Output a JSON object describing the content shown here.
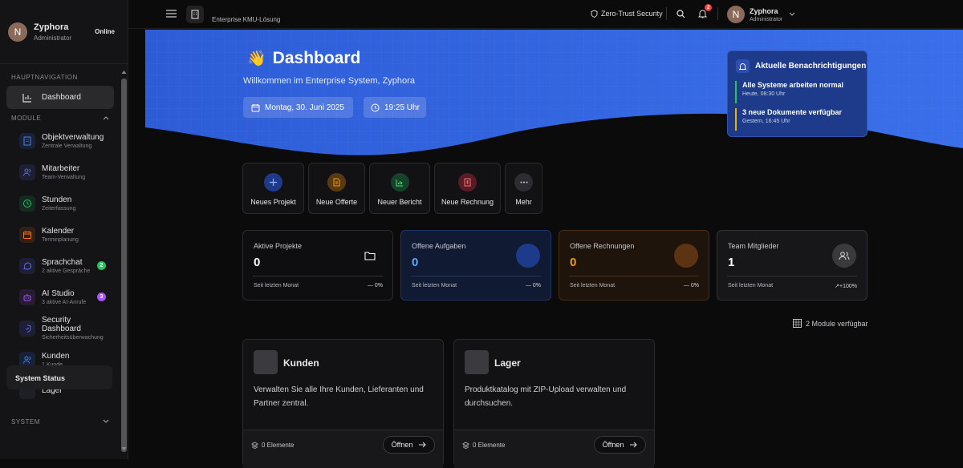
{
  "sidebar": {
    "user": {
      "initial": "N",
      "name": "Zyphora",
      "role": "Administrator",
      "status": "Online"
    },
    "nav_section": "HAUPTNAVIGATION",
    "dashboard_label": "Dashboard",
    "modules_section": "MODULE",
    "items": [
      {
        "label": "Objektverwaltung",
        "sub": "Zentrale Verwaltung",
        "icon": "building-icon",
        "color": "#3b82f6"
      },
      {
        "label": "Mitarbeiter",
        "sub": "Team-Verwaltung",
        "icon": "users-icon",
        "color": "#6366f1"
      },
      {
        "label": "Stunden",
        "sub": "Zeiterfassung",
        "icon": "clock-icon",
        "color": "#22c55e"
      },
      {
        "label": "Kalender",
        "sub": "Terminplanung",
        "icon": "calendar-icon",
        "color": "#f97316"
      },
      {
        "label": "Sprachchat",
        "sub": "2 aktive Gespräche",
        "icon": "chat-icon",
        "color": "#6366f1",
        "badge": "2",
        "badge_color": "#22c55e"
      },
      {
        "label": "AI Studio",
        "sub": "3 aktive AI-Anrufe",
        "icon": "bot-icon",
        "color": "#a855f7",
        "badge": "3",
        "badge_color": "#a855f7"
      },
      {
        "label": "Security Dashboard",
        "sub": "Sicherheitsüberwachung",
        "icon": "shield-icon",
        "color": "#6366f1"
      },
      {
        "label": "Kunden",
        "sub": "1 Kunde",
        "icon": "users-icon",
        "color": "#3b82f6"
      },
      {
        "label": "Lager",
        "sub": "",
        "icon": "box-icon",
        "color": "#64748b"
      }
    ],
    "system_section": "SYSTEM",
    "system_status": "System Status"
  },
  "topbar": {
    "subtitle": "Enterprise KMU-Lösung",
    "security_label": "Zero-Trust Security",
    "notification_count": "2",
    "user_initial": "N",
    "user_name": "Zyphora",
    "user_role": "Administrator"
  },
  "hero": {
    "emoji": "👋",
    "title": "Dashboard",
    "subtitle": "Willkommen im Enterprise System, Zyphora",
    "date": "Montag, 30. Juni 2025",
    "time": "19:25 Uhr"
  },
  "notifications": {
    "title": "Aktuelle Benachrichtigungen",
    "items": [
      {
        "text": "Alle Systeme arbeiten normal",
        "time": "Heute, 08:30 Uhr",
        "color": "#22c55e"
      },
      {
        "text": "3 neue Dokumente verfügbar",
        "time": "Gestern, 16:45 Uhr",
        "color": "#eab308"
      }
    ]
  },
  "quick_actions": [
    {
      "label": "Neues Projekt",
      "icon": "plus-icon",
      "color": "#3b82f6"
    },
    {
      "label": "Neue Offerte",
      "icon": "document-icon",
      "color": "#f59e0b"
    },
    {
      "label": "Neuer Bericht",
      "icon": "chart-icon",
      "color": "#22c55e"
    },
    {
      "label": "Neue Rechnung",
      "icon": "invoice-icon",
      "color": "#ef4444"
    },
    {
      "label": "Mehr",
      "icon": "more-icon",
      "color": "#9ca3af"
    }
  ],
  "stats": [
    {
      "title": "Aktive Projekte",
      "value": "0",
      "footer": "Seit letzten Monat",
      "delta": "— 0%",
      "value_color": "#ffffff"
    },
    {
      "title": "Offene Aufgaben",
      "value": "0",
      "footer": "Seit letzten Monat",
      "delta": "— 0%",
      "value_color": "#60a5fa"
    },
    {
      "title": "Offene Rechnungen",
      "value": "0",
      "footer": "Seit letzten Monat",
      "delta": "— 0%",
      "value_color": "#f59e0b"
    },
    {
      "title": "Team Mitglieder",
      "value": "1",
      "footer": "Seit letzten Monat",
      "delta": "↗+100%",
      "value_color": "#ffffff"
    }
  ],
  "modules_available": "2 Module verfügbar",
  "modules": [
    {
      "title": "Kunden",
      "description": "Verwalten Sie alle Ihre Kunden, Lieferanten und Partner zentral.",
      "count": "0 Elemente",
      "button": "Öffnen"
    },
    {
      "title": "Lager",
      "description": "Produktkatalog mit ZIP-Upload verwalten und durchsuchen.",
      "count": "0 Elemente",
      "button": "Öffnen"
    }
  ]
}
